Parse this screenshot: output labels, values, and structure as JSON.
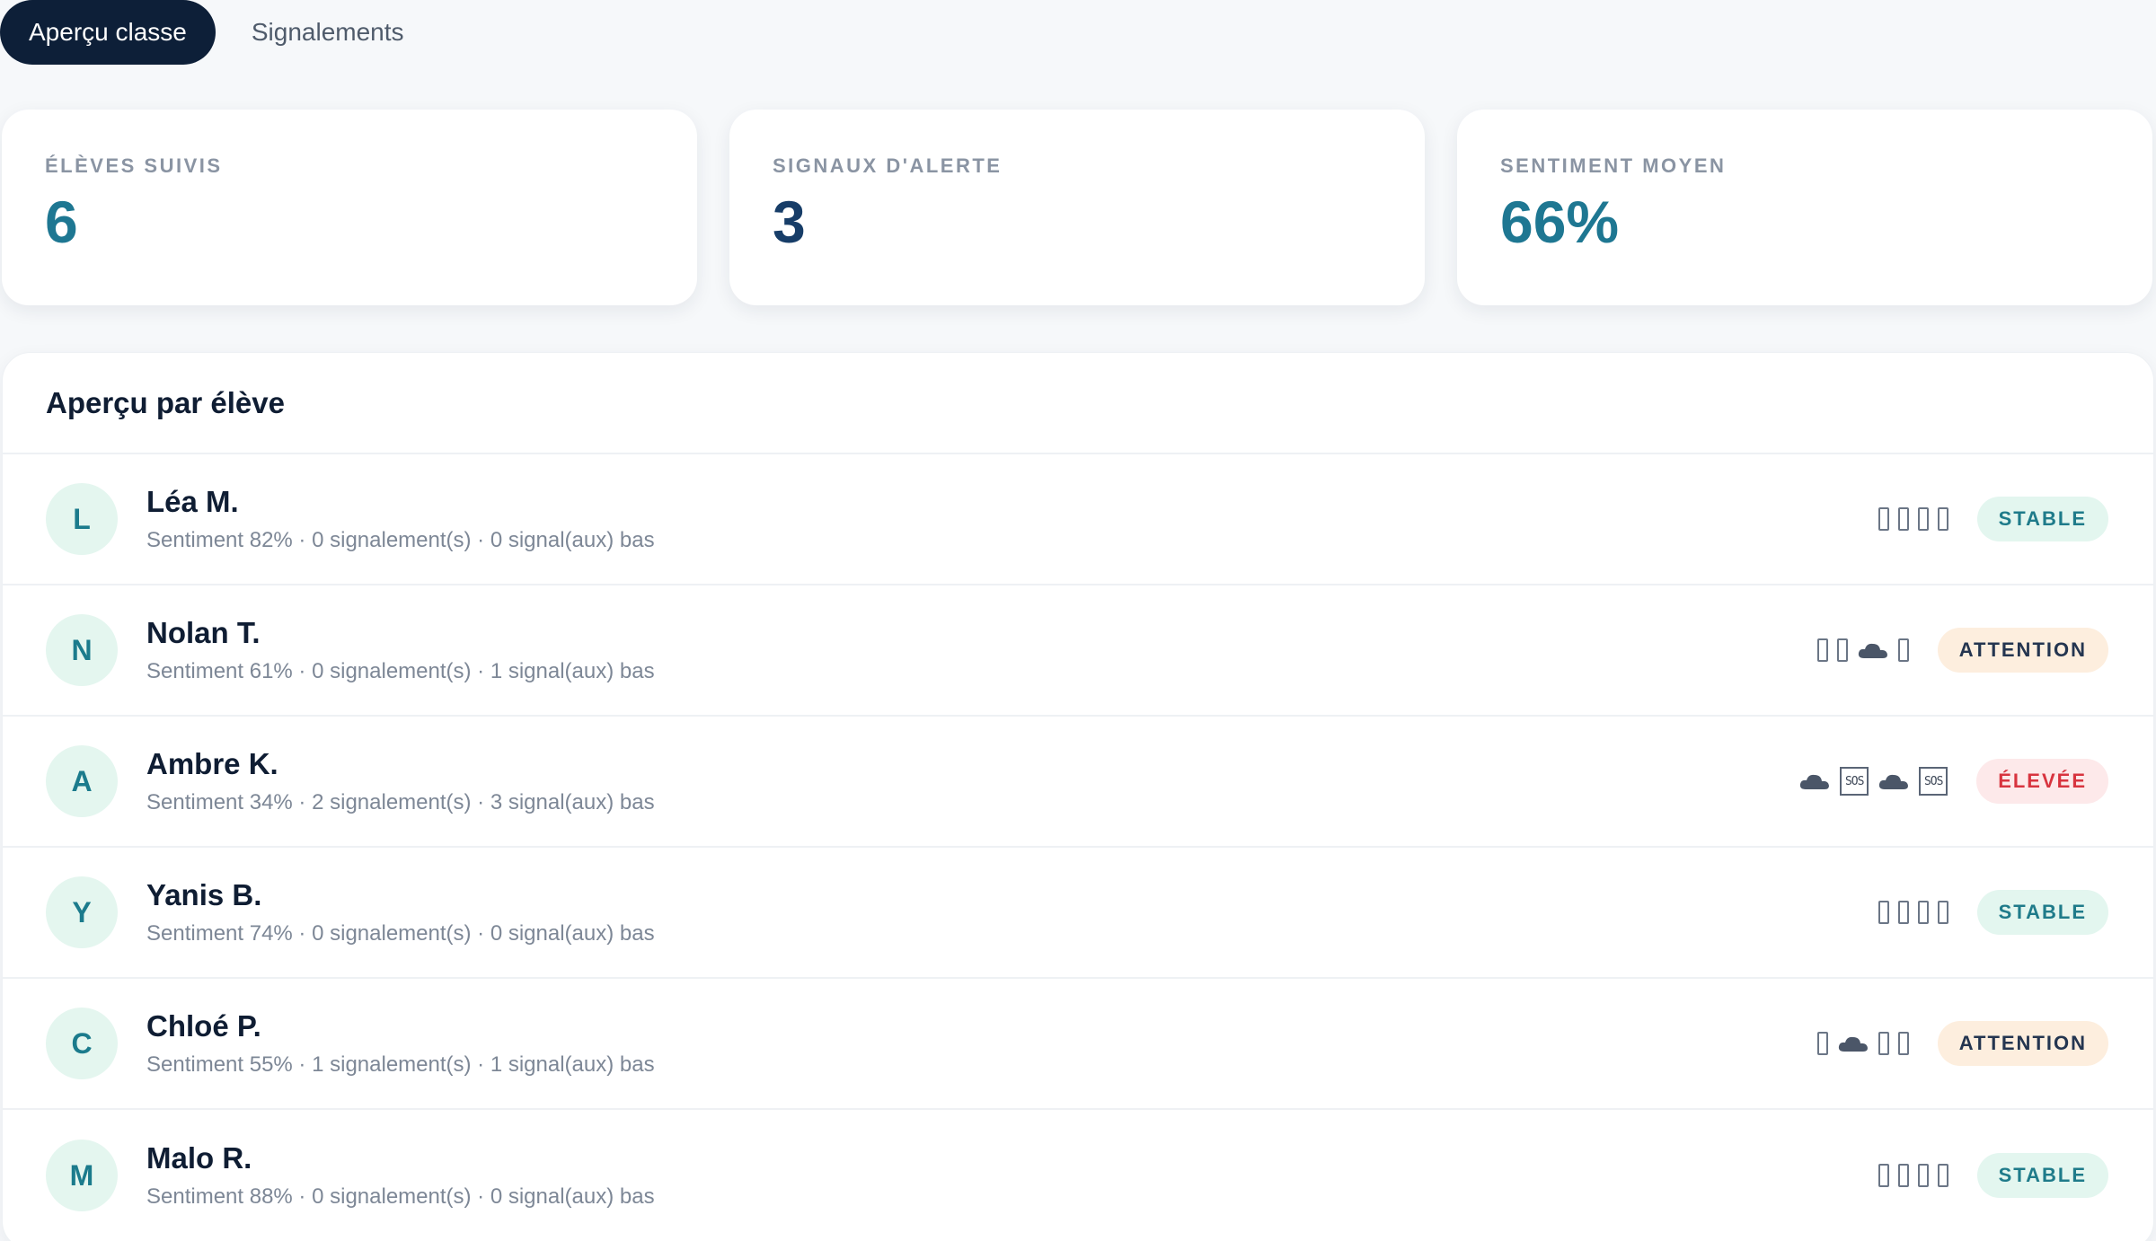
{
  "tabs": [
    {
      "label": "Aperçu classe",
      "active": true
    },
    {
      "label": "Signalements",
      "active": false
    }
  ],
  "stats": [
    {
      "label": "ÉLÈVES SUIVIS",
      "value": "6"
    },
    {
      "label": "SIGNAUX D'ALERTE",
      "value": "3"
    },
    {
      "label": "SENTIMENT MOYEN",
      "value": "66%"
    }
  ],
  "overview": {
    "title": "Aperçu par élève",
    "students": [
      {
        "initial": "L",
        "name": "Léa M.",
        "meta": "Sentiment 82% · 0 signalement(s) · 0 signal(aux) bas",
        "icons": [
          "glyph",
          "glyph",
          "glyph",
          "glyph"
        ],
        "status": "STABLE"
      },
      {
        "initial": "N",
        "name": "Nolan T.",
        "meta": "Sentiment 61% · 0 signalement(s) · 1 signal(aux) bas",
        "icons": [
          "glyph",
          "glyph",
          "cloud",
          "glyph"
        ],
        "status": "ATTENTION"
      },
      {
        "initial": "A",
        "name": "Ambre K.",
        "meta": "Sentiment 34% · 2 signalement(s) · 3 signal(aux) bas",
        "icons": [
          "cloud",
          "sos",
          "cloud",
          "sos"
        ],
        "status": "ÉLEVÉE"
      },
      {
        "initial": "Y",
        "name": "Yanis B.",
        "meta": "Sentiment 74% · 0 signalement(s) · 0 signal(aux) bas",
        "icons": [
          "glyph",
          "glyph",
          "glyph",
          "glyph"
        ],
        "status": "STABLE"
      },
      {
        "initial": "C",
        "name": "Chloé P.",
        "meta": "Sentiment 55% · 1 signalement(s) · 1 signal(aux) bas",
        "icons": [
          "glyph",
          "cloud",
          "glyph",
          "glyph"
        ],
        "status": "ATTENTION"
      },
      {
        "initial": "M",
        "name": "Malo R.",
        "meta": "Sentiment 88% · 0 signalement(s) · 0 signal(aux) bas",
        "icons": [
          "glyph",
          "glyph",
          "glyph",
          "glyph"
        ],
        "status": "STABLE"
      }
    ]
  },
  "sos_label": "SOS",
  "colors": {
    "navy": "#0d1f38",
    "teal": "#1e7792",
    "stable_bg": "#e3f6ef",
    "attention_bg": "#fdeede",
    "elevee_bg": "#fde9ea",
    "elevee_text": "#d8343f"
  }
}
